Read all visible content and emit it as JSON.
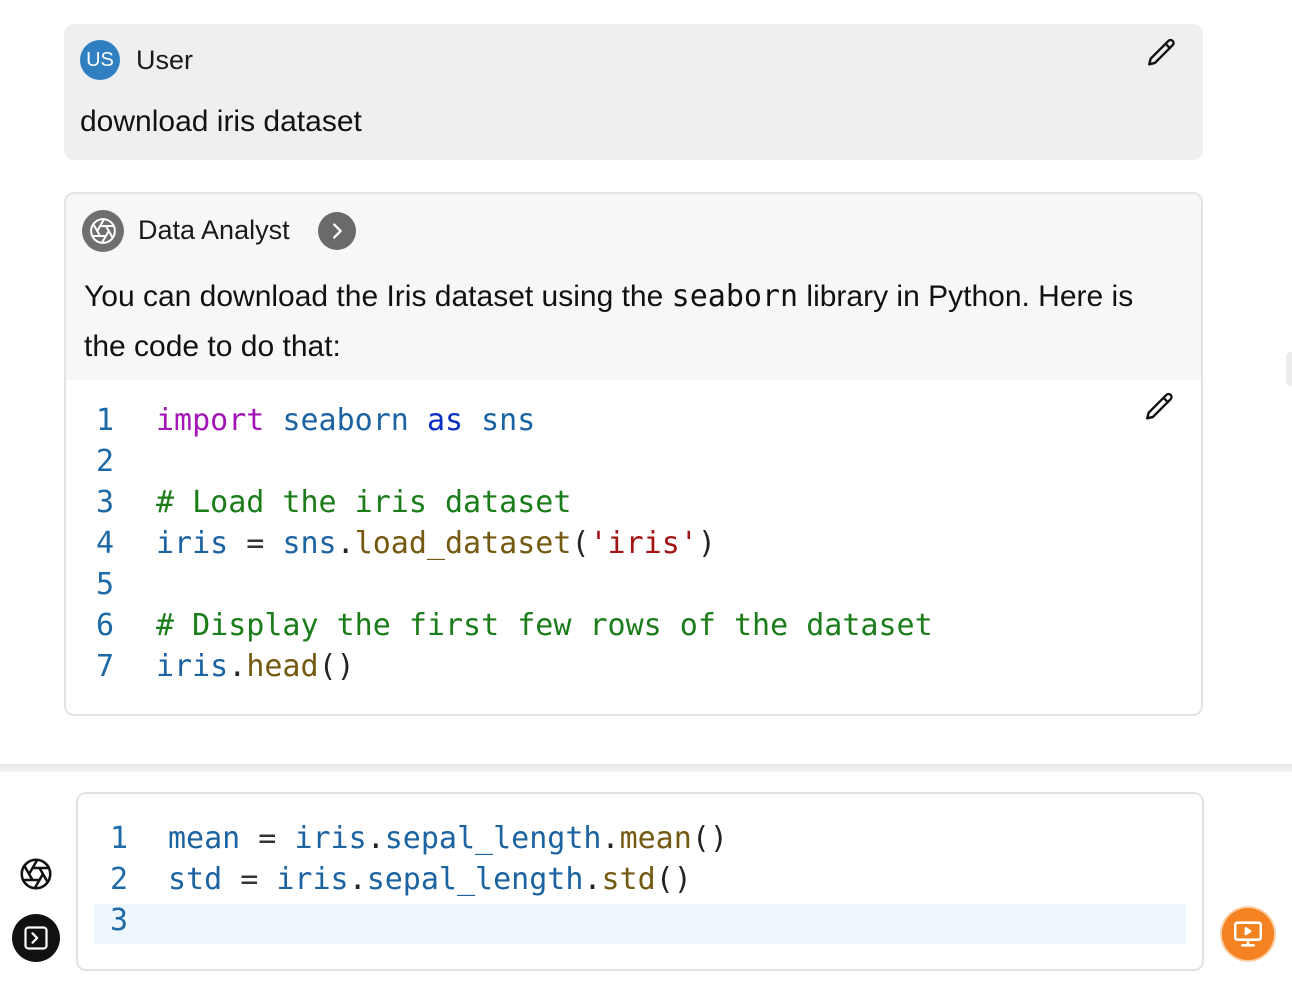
{
  "user_message": {
    "avatar_initials": "US",
    "author": "User",
    "text": "download iris dataset"
  },
  "assistant_message": {
    "author": "Data Analyst",
    "text_before_code": "You can download the Iris dataset using the ",
    "inline_code": "seaborn",
    "text_after_code": " library in Python. Here is the code to do that:",
    "code_lines": [
      {
        "n": "1",
        "tokens": [
          [
            "kw",
            "import"
          ],
          [
            "p",
            " "
          ],
          [
            "id",
            "seaborn"
          ],
          [
            "p",
            " "
          ],
          [
            "as",
            "as"
          ],
          [
            "p",
            " "
          ],
          [
            "id",
            "sns"
          ]
        ]
      },
      {
        "n": "2",
        "tokens": []
      },
      {
        "n": "3",
        "tokens": [
          [
            "cm",
            "# Load the iris dataset"
          ]
        ]
      },
      {
        "n": "4",
        "tokens": [
          [
            "id",
            "iris"
          ],
          [
            "op",
            " = "
          ],
          [
            "id",
            "sns"
          ],
          [
            "p",
            "."
          ],
          [
            "fn",
            "load_dataset"
          ],
          [
            "p",
            "("
          ],
          [
            "str",
            "'iris'"
          ],
          [
            "p",
            ")"
          ]
        ]
      },
      {
        "n": "5",
        "tokens": []
      },
      {
        "n": "6",
        "tokens": [
          [
            "cm",
            "# Display the first few rows of the dataset"
          ]
        ]
      },
      {
        "n": "7",
        "tokens": [
          [
            "id",
            "iris"
          ],
          [
            "p",
            "."
          ],
          [
            "fn",
            "head"
          ],
          [
            "p",
            "()"
          ]
        ]
      }
    ]
  },
  "editor": {
    "code_lines": [
      {
        "n": "1",
        "tokens": [
          [
            "id",
            "mean"
          ],
          [
            "op",
            " = "
          ],
          [
            "id",
            "iris"
          ],
          [
            "p",
            "."
          ],
          [
            "id",
            "sepal_length"
          ],
          [
            "p",
            "."
          ],
          [
            "fn",
            "mean"
          ],
          [
            "p",
            "()"
          ]
        ]
      },
      {
        "n": "2",
        "tokens": [
          [
            "id",
            "std"
          ],
          [
            "op",
            " = "
          ],
          [
            "id",
            "iris"
          ],
          [
            "p",
            "."
          ],
          [
            "id",
            "sepal_length"
          ],
          [
            "p",
            "."
          ],
          [
            "fn",
            "std"
          ],
          [
            "p",
            "()"
          ]
        ]
      },
      {
        "n": "3",
        "tokens": []
      }
    ],
    "current_line": 3
  },
  "icons": {
    "edit": "pencil-icon",
    "assistant_avatar": "aperture-icon",
    "expand": "chevron-right-icon",
    "terminal": "terminal-icon",
    "run": "presentation-play-icon"
  },
  "colors": {
    "user_avatar": "#2f7fc1",
    "run_button": "#f58220",
    "keyword": "#a116b5",
    "comment": "#1a7d1a",
    "string": "#a31515",
    "function": "#735a10",
    "identifier": "#1c63a2"
  }
}
